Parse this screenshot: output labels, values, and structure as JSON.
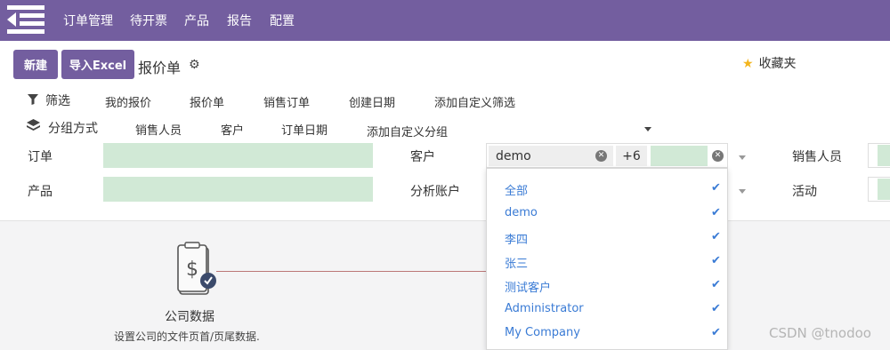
{
  "topnav": {
    "items": [
      "订单管理",
      "待开票",
      "产品",
      "报告",
      "配置"
    ]
  },
  "control": {
    "new_label": "新建",
    "import_label": "导入Excel",
    "title": "报价单",
    "favorites_label": "收藏夹"
  },
  "filters": {
    "head": "筛选",
    "items": [
      "我的报价",
      "报价单",
      "销售订单",
      "创建日期",
      "添加自定义筛选"
    ]
  },
  "groupby": {
    "head": "分组方式",
    "items": [
      "销售人员",
      "客户",
      "订单日期",
      "添加自定义分组"
    ]
  },
  "fields": {
    "order_label": "订单",
    "product_label": "产品",
    "customer_label": "客户",
    "analytic_label": "分析账户",
    "salesperson_label": "销售人员",
    "activity_label": "活动",
    "customer_tag": "demo",
    "customer_more": "+6"
  },
  "dropdown": {
    "items": [
      "全部",
      "demo",
      "李四",
      "张三",
      "测试客户",
      "Administrator",
      "My Company"
    ]
  },
  "company": {
    "title": "公司数据",
    "subtitle": "设置公司的文件页首/页尾数据."
  },
  "watermark": "CSDN @tnodoo",
  "colors": {
    "brand": "#735e9f",
    "field_green": "#d1e9d6",
    "link_blue": "#3a7bd5"
  },
  "icons": {
    "menu": "menu-toggle-icon",
    "gear": "gear-icon",
    "star": "star-icon",
    "filter": "filter-icon",
    "group": "layers-icon",
    "check": "check-icon",
    "document": "document-dollar-icon"
  }
}
